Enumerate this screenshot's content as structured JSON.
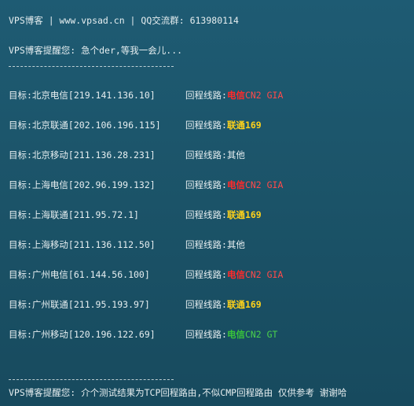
{
  "header": {
    "line1": "VPS博客 | www.vpsad.cn | QQ交流群: 613980114",
    "line2": "VPS博客提醒您: 急个der,等我一会儿..."
  },
  "rows": [
    {
      "target": "目标:北京电信[219.141.136.10]",
      "route_prefix": "回程线路:",
      "isp": "电信",
      "line": "CN2 GIA",
      "color": "red"
    },
    {
      "target": "目标:北京联通[202.106.196.115]",
      "route_prefix": "回程线路:",
      "isp": "联通",
      "line": "169",
      "color": "yellow"
    },
    {
      "target": "目标:北京移动[211.136.28.231]",
      "route_prefix": "回程线路:",
      "isp": "其他",
      "line": "",
      "color": "other"
    },
    {
      "target": "目标:上海电信[202.96.199.132]",
      "route_prefix": "回程线路:",
      "isp": "电信",
      "line": "CN2 GIA",
      "color": "red"
    },
    {
      "target": "目标:上海联通[211.95.72.1]",
      "route_prefix": "回程线路:",
      "isp": "联通",
      "line": "169",
      "color": "yellow"
    },
    {
      "target": "目标:上海移动[211.136.112.50]",
      "route_prefix": "回程线路:",
      "isp": "其他",
      "line": "",
      "color": "other"
    },
    {
      "target": "目标:广州电信[61.144.56.100]",
      "route_prefix": "回程线路:",
      "isp": "电信",
      "line": "CN2 GIA",
      "color": "red"
    },
    {
      "target": "目标:广州联通[211.95.193.97]",
      "route_prefix": "回程线路:",
      "isp": "联通",
      "line": "169",
      "color": "yellow"
    },
    {
      "target": "目标:广州移动[120.196.122.69]",
      "route_prefix": "回程线路:",
      "isp": "电信",
      "line": "CN2 GT",
      "color": "green"
    }
  ],
  "footer": {
    "line": "VPS博客提醒您: 介个测试结果为TCP回程路由,不似CMP回程路由 仅供参考 谢谢哈"
  },
  "colors": {
    "red": "#ff2a2a",
    "yellow": "#ffd21a",
    "green": "#38c23a",
    "background": "#1b5368",
    "text": "#e6eef0"
  }
}
